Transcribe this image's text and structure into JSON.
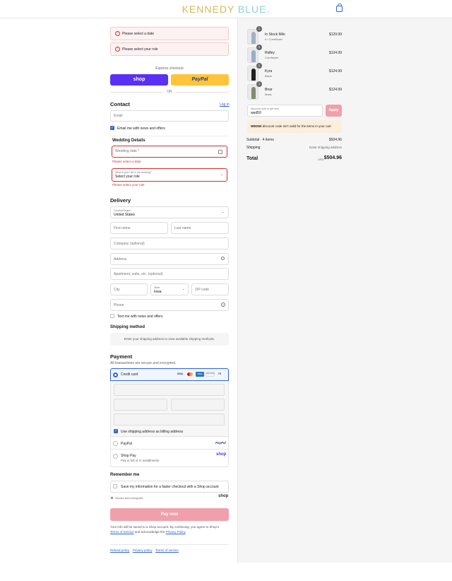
{
  "header": {
    "logo_part1": "KENNEDY",
    "logo_part2": "BLUE",
    "logo_dot": "."
  },
  "errors": {
    "date_banner": "Please select a date",
    "role_banner": "Please select your role"
  },
  "express": {
    "label": "Express checkout",
    "shop": "shop",
    "paypal": "PayPal",
    "or": "OR"
  },
  "contact": {
    "title": "Contact",
    "login": "Log in",
    "email_placeholder": "Email",
    "email_news": "Email me with news and offers"
  },
  "wedding": {
    "title": "Wedding Details",
    "date_placeholder": "Wedding date *",
    "date_error": "Please select a date",
    "role_caption": "What is your role in the wedding?",
    "role_value": "Select your role",
    "role_error": "Please select your role"
  },
  "delivery": {
    "title": "Delivery",
    "country_caption": "Country/Region",
    "country_value": "United States",
    "first_name": "First name",
    "last_name": "Last name",
    "company": "Company (optional)",
    "address": "Address",
    "apartment": "Apartment, suite, etc. (optional)",
    "city": "City",
    "state_caption": "State",
    "state_value": "Iowa",
    "zip": "ZIP code",
    "phone": "Phone",
    "text_news": "Text me with news and offers"
  },
  "shipping": {
    "title": "Shipping method",
    "note": "Enter your shipping address to view available shipping methods."
  },
  "payment": {
    "title": "Payment",
    "subtitle": "All transactions are secure and encrypted.",
    "credit_card": "Credit card",
    "card_brands": [
      "VISA",
      "MC",
      "AMEX",
      "DISCOVER"
    ],
    "more_brands": "+5",
    "billing_same": "Use shipping address as billing address",
    "paypal": "PayPal",
    "paypal_logo": "PayPal",
    "shop_pay": "Shop Pay",
    "shop_pay_sub": "Pay in full or in installments",
    "shop_pay_logo": "shop"
  },
  "remember": {
    "title": "Remember me",
    "save_info": "Save my information for a faster checkout with a Shop account",
    "secure": "Secure and encrypted",
    "shop_logo": "shop"
  },
  "pay_now": "Pay now",
  "legal": {
    "line1": "Your info will be saved to a Shop account. By continuing, you agree to Shop's",
    "tos": "Terms of Service",
    "and": "and acknowledge the",
    "privacy": "Privacy Policy",
    "period": "."
  },
  "footer": {
    "refund": "Refund policy",
    "privacy": "Privacy policy",
    "terms": "Terms of service"
  },
  "cart": {
    "items": [
      {
        "name": "In Stock Milo",
        "variant": "6 / Cornflower",
        "price": "$129.99",
        "qty": "1",
        "color": "#9fb1c8"
      },
      {
        "name": "Ridley",
        "variant": "Cornflower",
        "price": "$124.99",
        "qty": "1",
        "color": "#9aacc6"
      },
      {
        "name": "Kyra",
        "variant": "Black",
        "price": "$124.99",
        "qty": "1",
        "color": "#1f1f1f"
      },
      {
        "name": "Briar",
        "variant": "Moss",
        "price": "$124.99",
        "qty": "1",
        "color": "#7f8d6e"
      }
    ],
    "discount_caption": "Discount code or gift card",
    "discount_value": "wed50",
    "apply": "Apply",
    "warning_code": "WED50",
    "warning_text": " discount code isn't valid for the items in your cart",
    "subtotal_label": "Subtotal · 4 items",
    "subtotal": "$504.96",
    "shipping_label": "Shipping",
    "shipping_value": "Enter shipping address",
    "total_label": "Total",
    "currency": "USD",
    "total": "$504.96"
  },
  "colors": {
    "accent": "#2f63d8",
    "error": "#d32f2f",
    "shop_button": "#5a31f4",
    "paypal_button": "#ffc439",
    "pay_now": "#f0a0aa"
  }
}
